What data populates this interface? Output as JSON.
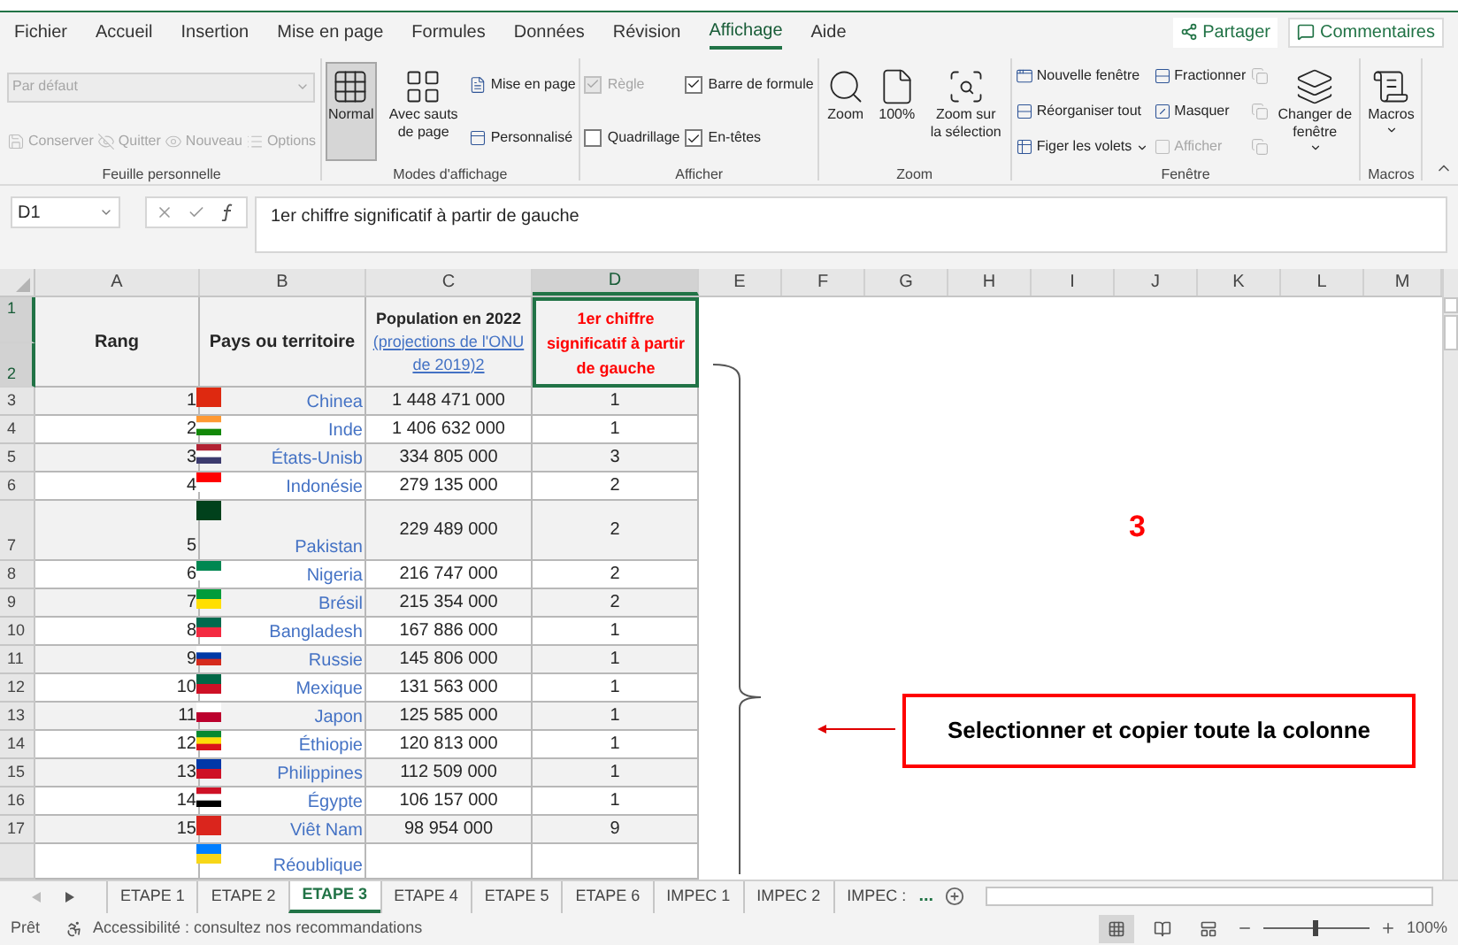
{
  "menu_tabs": [
    {
      "label": "Fichier",
      "selected": false
    },
    {
      "label": "Accueil",
      "selected": false
    },
    {
      "label": "Insertion",
      "selected": false
    },
    {
      "label": "Mise en page",
      "selected": false
    },
    {
      "label": "Formules",
      "selected": false
    },
    {
      "label": "Données",
      "selected": false
    },
    {
      "label": "Révision",
      "selected": false
    },
    {
      "label": "Affichage",
      "selected": true
    },
    {
      "label": "Aide",
      "selected": false
    }
  ],
  "share_button": "Partager",
  "comments_button": "Commentaires",
  "ribbon": {
    "groups": [
      {
        "label": "Feuille personnelle",
        "columns": [
          [
            {
              "kind": "dropdown",
              "placeholder": "Par défaut",
              "disabled": true
            },
            {
              "kind": "buttonrow",
              "items": [
                {
                  "kind": "small",
                  "label": "Conserver",
                  "disabled": true
                },
                {
                  "kind": "small",
                  "label": "Quitter",
                  "disabled": true
                },
                {
                  "kind": "small",
                  "label": "Nouveau",
                  "disabled": true
                },
                {
                  "kind": "small",
                  "label": "Options",
                  "disabled": true
                }
              ]
            }
          ]
        ]
      },
      {
        "label": "Modes d'affichage",
        "columns": [
          [
            {
              "kind": "large",
              "label": "Normal",
              "selected": true,
              "disabled": false
            }
          ],
          [
            {
              "kind": "large",
              "label": "Avec sauts de page",
              "selected": false,
              "disabled": false
            }
          ],
          [
            {
              "kind": "small",
              "label": "Mise en page",
              "disabled": false
            },
            {
              "kind": "small",
              "label": "Personnalisé",
              "disabled": false
            }
          ]
        ]
      },
      {
        "label": "Afficher",
        "columns": [
          [
            {
              "kind": "check",
              "label": "Règle",
              "checked": true,
              "disabled": true
            },
            {
              "kind": "check",
              "label": "Quadrillage",
              "checked": false,
              "disabled": false
            }
          ],
          [
            {
              "kind": "check",
              "label": "Barre de formule",
              "checked": true,
              "disabled": false
            },
            {
              "kind": "check",
              "label": "En-têtes",
              "checked": true,
              "disabled": false
            }
          ]
        ]
      },
      {
        "label": "Zoom",
        "columns": [
          [
            {
              "kind": "large",
              "label": "Zoom",
              "selected": false,
              "disabled": false
            }
          ],
          [
            {
              "kind": "large",
              "label": "100%",
              "selected": false,
              "disabled": false
            }
          ],
          [
            {
              "kind": "large",
              "label": "Zoom sur la sélection",
              "selected": false,
              "disabled": false
            }
          ]
        ]
      },
      {
        "label": "Fenêtre",
        "columns": [
          [
            {
              "kind": "small",
              "label": "Nouvelle fenêtre",
              "disabled": false
            },
            {
              "kind": "small",
              "label": "Réorganiser tout",
              "disabled": false
            },
            {
              "kind": "small",
              "label": "Figer les volets",
              "disabled": false,
              "has_menu": true
            }
          ],
          [
            {
              "kind": "small",
              "label": "Fractionner",
              "disabled": false
            },
            {
              "kind": "small",
              "label": "Masquer",
              "disabled": false
            },
            {
              "kind": "small",
              "label": "Afficher",
              "disabled": true
            }
          ],
          [
            {
              "kind": "icon",
              "disabled": true
            },
            {
              "kind": "icon",
              "disabled": true
            },
            {
              "kind": "icon",
              "disabled": true
            }
          ],
          [
            {
              "kind": "large",
              "label": "Changer de fenêtre",
              "selected": false,
              "disabled": false,
              "has_menu": true
            }
          ]
        ]
      },
      {
        "label": "Macros",
        "columns": [
          [
            {
              "kind": "large",
              "label": "Macros",
              "selected": false,
              "disabled": false,
              "has_menu": true
            }
          ]
        ]
      }
    ]
  },
  "formula_bar": {
    "name_box": "D1",
    "content": "1er chiffre significatif à partir de gauche"
  },
  "sheet": {
    "column_headers": [
      {
        "label": "A",
        "selected": false
      },
      {
        "label": "B",
        "selected": false
      },
      {
        "label": "C",
        "selected": false
      },
      {
        "label": "D",
        "selected": true
      },
      {
        "label": "E",
        "selected": false
      },
      {
        "label": "F",
        "selected": false
      },
      {
        "label": "G",
        "selected": false
      },
      {
        "label": "H",
        "selected": false
      },
      {
        "label": "I",
        "selected": false
      },
      {
        "label": "J",
        "selected": false
      },
      {
        "label": "K",
        "selected": false
      },
      {
        "label": "L",
        "selected": false
      },
      {
        "label": "M",
        "selected": false
      }
    ],
    "header_rows": [
      {
        "label": "1",
        "selected": true
      },
      {
        "label": "2",
        "selected": true
      }
    ],
    "headers": {
      "rank": "Rang",
      "country": "Pays ou territoire",
      "population": "Population en 2022",
      "population_link": "(projections de l'ONU de 2019)2",
      "digit": "1er chiffre significatif à partir de gauche"
    },
    "rows": [
      {
        "row": "3",
        "rank": "1",
        "country": "Chinea",
        "population": "1 448 471 000",
        "digit": "1"
      },
      {
        "row": "4",
        "rank": "2",
        "country": "Inde",
        "population": "1 406 632 000",
        "digit": "1"
      },
      {
        "row": "5",
        "rank": "3",
        "country": "États-Unisb",
        "population": "334 805 000",
        "digit": "3"
      },
      {
        "row": "6",
        "rank": "4",
        "country": "Indonésie",
        "population": "279 135 000",
        "digit": "2"
      },
      {
        "row": "7",
        "rank": "5",
        "country": "Pakistan",
        "population": "229 489 000",
        "digit": "2",
        "tall": true
      },
      {
        "row": "8",
        "rank": "6",
        "country": "Nigeria",
        "population": "216 747 000",
        "digit": "2"
      },
      {
        "row": "9",
        "rank": "7",
        "country": "Brésil",
        "population": "215 354 000",
        "digit": "2"
      },
      {
        "row": "10",
        "rank": "8",
        "country": "Bangladesh",
        "population": "167 886 000",
        "digit": "1"
      },
      {
        "row": "11",
        "rank": "9",
        "country": "Russie",
        "population": "145 806 000",
        "digit": "1"
      },
      {
        "row": "12",
        "rank": "10",
        "country": "Mexique",
        "population": "131 563 000",
        "digit": "1"
      },
      {
        "row": "13",
        "rank": "11",
        "country": "Japon",
        "population": "125 585 000",
        "digit": "1"
      },
      {
        "row": "14",
        "rank": "12",
        "country": "Éthiopie",
        "population": "120 813 000",
        "digit": "1"
      },
      {
        "row": "15",
        "rank": "13",
        "country": "Philippines",
        "population": "112 509 000",
        "digit": "1"
      },
      {
        "row": "16",
        "rank": "14",
        "country": "Égypte",
        "population": "106 157 000",
        "digit": "1"
      },
      {
        "row": "17",
        "rank": "15",
        "country": "Viêt Nam",
        "population": "98 954 000",
        "digit": "9"
      },
      {
        "country": "Réoublique"
      }
    ]
  },
  "annotation": {
    "number": "3",
    "callout": "Selectionner et copier toute la colonne"
  },
  "sheet_tabs": [
    {
      "label": "ETAPE 1",
      "selected": false
    },
    {
      "label": "ETAPE 2",
      "selected": false
    },
    {
      "label": "ETAPE 3",
      "selected": true
    },
    {
      "label": "ETAPE 4",
      "selected": false
    },
    {
      "label": "ETAPE 5",
      "selected": false
    },
    {
      "label": "ETAPE 6",
      "selected": false
    },
    {
      "label": "IMPEC 1",
      "selected": false
    },
    {
      "label": "IMPEC 2",
      "selected": false
    },
    {
      "label": "IMPEC :",
      "selected": false
    }
  ],
  "more_tabs": "...",
  "status_bar": {
    "ready": "Prêt",
    "accessibility": "Accessibilité : consultez nos recommandations",
    "views": [
      {
        "selected": true
      },
      {
        "selected": false
      },
      {
        "selected": false
      }
    ],
    "zoom_slider": {
      "level": 0.5
    },
    "zoom": "100%"
  }
}
